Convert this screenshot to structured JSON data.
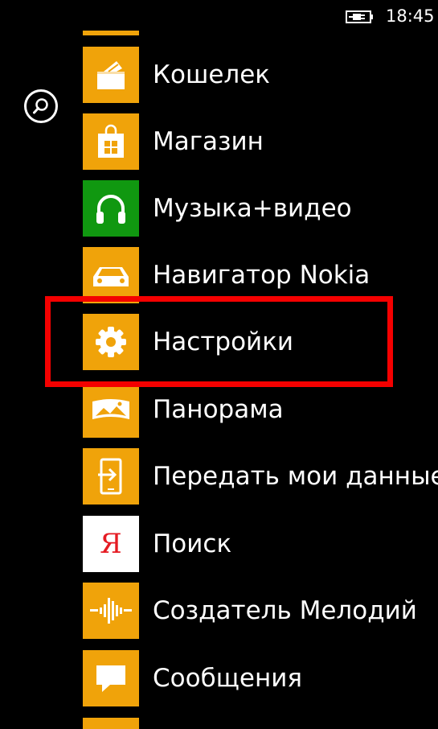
{
  "status_bar": {
    "time": "18:45",
    "battery_icon": "battery-charging-icon"
  },
  "search": {
    "icon": "search-icon"
  },
  "apps": [
    {
      "label": "Кошелек",
      "icon": "wallet-icon",
      "tile_color": "#F0A30A"
    },
    {
      "label": "Магазин",
      "icon": "store-icon",
      "tile_color": "#F0A30A"
    },
    {
      "label": "Музыка+видео",
      "icon": "headphones-icon",
      "tile_color": "#109810"
    },
    {
      "label": "Навигатор Nokia",
      "icon": "car-icon",
      "tile_color": "#F0A30A"
    },
    {
      "label": "Настройки",
      "icon": "gear-icon",
      "tile_color": "#F0A30A"
    },
    {
      "label": "Панорама",
      "icon": "panorama-icon",
      "tile_color": "#F0A30A"
    },
    {
      "label": "Передать мои данные",
      "icon": "transfer-phone-icon",
      "tile_color": "#F0A30A"
    },
    {
      "label": "Поиск",
      "icon": "yandex-icon",
      "tile_color": "#FFFFFF",
      "glyph": "Я"
    },
    {
      "label": "Создатель Мелодий",
      "icon": "waveform-icon",
      "tile_color": "#F0A30A"
    },
    {
      "label": "Сообщения",
      "icon": "message-icon",
      "tile_color": "#F0A30A"
    }
  ],
  "highlight_color": "#F40000"
}
